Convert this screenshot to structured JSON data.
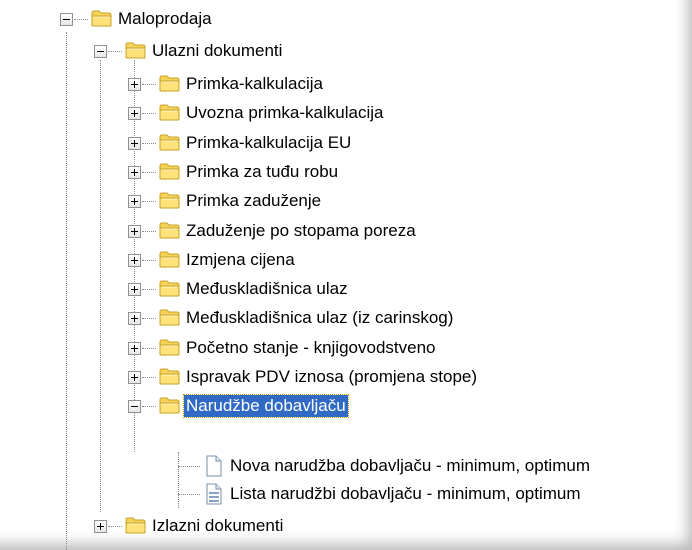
{
  "tree": {
    "root": {
      "label": "Maloprodaja",
      "expanded": true,
      "icon": "folder-icon"
    },
    "ulazni": {
      "label": "Ulazni dokumenti",
      "expanded": true,
      "icon": "folder-icon"
    },
    "children": [
      {
        "label": "Primka-kalkulacija",
        "expanded": false
      },
      {
        "label": "Uvozna primka-kalkulacija",
        "expanded": false
      },
      {
        "label": "Primka-kalkulacija EU",
        "expanded": false
      },
      {
        "label": "Primka za tuđu robu",
        "expanded": false
      },
      {
        "label": "Primka zaduženje",
        "expanded": false
      },
      {
        "label": "Zaduženje po stopama poreza",
        "expanded": false
      },
      {
        "label": "Izmjena cijena",
        "expanded": false
      },
      {
        "label": "Međuskladišnica ulaz",
        "expanded": false
      },
      {
        "label": "Međuskladišnica ulaz (iz carinskog)",
        "expanded": false
      },
      {
        "label": "Početno stanje - knjigovodstveno",
        "expanded": false
      },
      {
        "label": "Ispravak PDV iznosa (promjena stope)",
        "expanded": false
      },
      {
        "label": "Narudžbe dobavljaču",
        "expanded": true,
        "selected": true
      }
    ],
    "narudzbe_children": [
      {
        "label": "Nova narudžba dobavljaču - minimum, optimum",
        "icon": "blank-document-icon"
      },
      {
        "label": "Lista narudžbi dobavljaču - minimum, optimum",
        "icon": "list-document-icon"
      }
    ],
    "izlazni": {
      "label": "Izlazni dokumenti",
      "expanded": false,
      "icon": "folder-icon"
    }
  },
  "colors": {
    "selection_bg": "#316ac5",
    "selection_text": "#ffffff",
    "tree_lines": "#8a8a8a",
    "folder_fill": "#f5d35a",
    "folder_edge": "#c9a227"
  }
}
